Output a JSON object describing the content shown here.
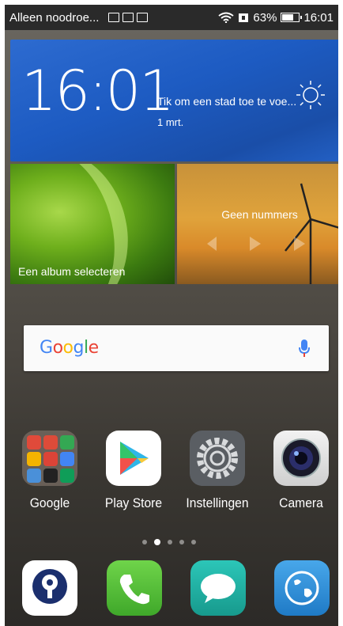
{
  "status_bar": {
    "carrier": "Alleen noodroe...",
    "battery_percent": "63%",
    "time": "16:01",
    "icons": [
      "keyboard-icon",
      "image-icon",
      "mail-icon",
      "wifi-icon",
      "sim-icon",
      "battery-icon"
    ]
  },
  "weather": {
    "time": "16:01",
    "city_prompt": "Tik om een stad toe te voe...",
    "date": "1 mrt.",
    "icon": "sun-icon"
  },
  "gallery": {
    "label": "Een album selecteren"
  },
  "music": {
    "title": "Geen nummers",
    "controls": [
      "previous-icon",
      "play-icon",
      "next-icon"
    ]
  },
  "search": {
    "brand": "Google",
    "icon": "mic-icon"
  },
  "apps": [
    {
      "label": "Google",
      "icon": "folder-icon"
    },
    {
      "label": "Play Store",
      "icon": "play-store-icon"
    },
    {
      "label": "Instellingen",
      "icon": "settings-gear-icon"
    },
    {
      "label": "Camera",
      "icon": "camera-icon"
    }
  ],
  "pages": {
    "count": 5,
    "active": 2
  },
  "dock": [
    "pin-icon",
    "phone-icon",
    "messages-icon",
    "browser-globe-icon"
  ],
  "colors": {
    "weather_bg": "#1d5bc2",
    "phone_green": "#5ac23a",
    "messages_teal": "#22b5a6",
    "browser_blue": "#2b8fd6"
  }
}
